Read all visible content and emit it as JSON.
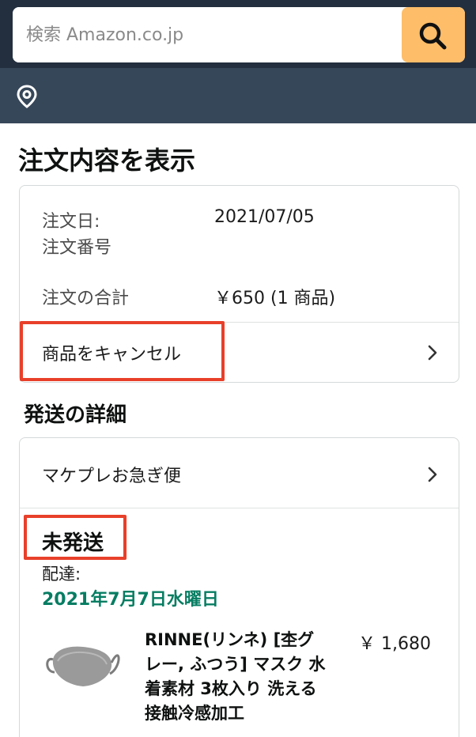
{
  "search": {
    "placeholder": "検索 Amazon.co.jp",
    "icon": "search-icon"
  },
  "location": {
    "icon": "location-pin-icon"
  },
  "page_title": "注文内容を表示",
  "order": {
    "date_label": "注文日:",
    "date_value": "2021/07/05",
    "number_label": "注文番号",
    "total_label": "注文の合計",
    "total_value": "￥650 (1 商品)",
    "cancel_label": "商品をキャンセル"
  },
  "shipping": {
    "section_title": "発送の詳細",
    "method": "マケプレお急ぎ便",
    "status": "未発送",
    "delivery_label": "配達:",
    "delivery_date": "2021年7月7日水曜日"
  },
  "product": {
    "title": "RINNE(リンネ) [杢グレー, ふつう] マスク 水着素材 3枚入り 洗える 接触冷感加工",
    "price": "￥ 1,680",
    "image_icon": "mask-product-image"
  },
  "colors": {
    "header_dark": "#232f3e",
    "header_sub": "#37475a",
    "search_button": "#febd69",
    "highlight": "#e8402a",
    "delivery_green": "#067d62"
  }
}
